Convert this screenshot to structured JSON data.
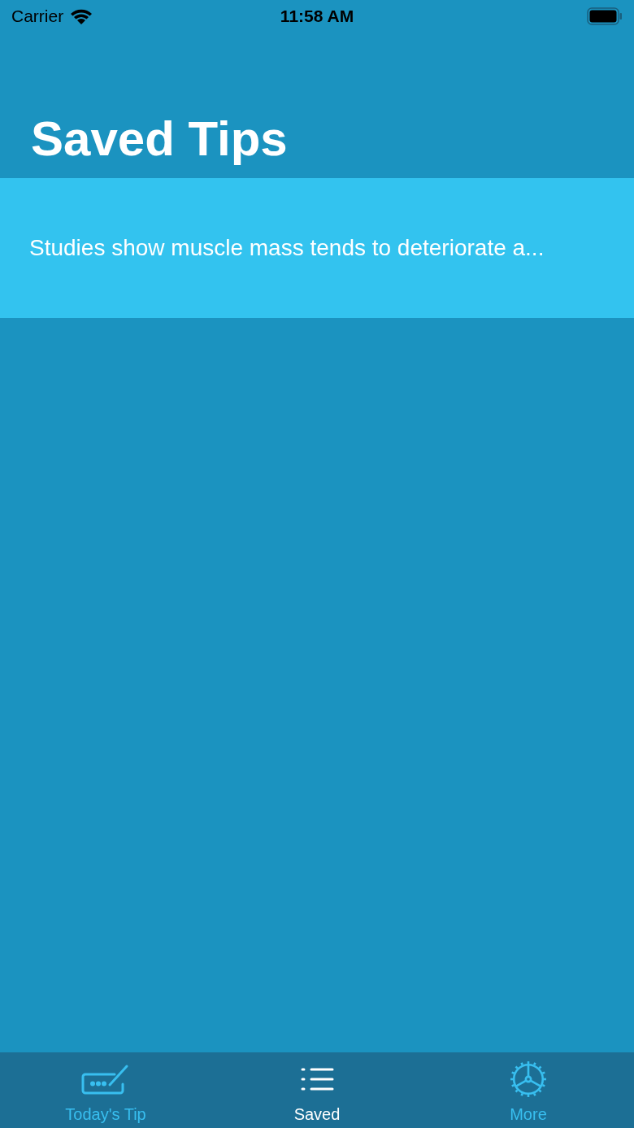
{
  "status_bar": {
    "carrier": "Carrier",
    "time": "11:58 AM"
  },
  "title": "Saved Tips",
  "tips": [
    {
      "text": "Studies show muscle mass tends to deteriorate a..."
    }
  ],
  "tab_bar": [
    {
      "kind": "compose",
      "label": "Today's Tip",
      "selected": false
    },
    {
      "kind": "list",
      "label": "Saved",
      "selected": true
    },
    {
      "kind": "gear",
      "label": "More",
      "selected": false
    }
  ]
}
